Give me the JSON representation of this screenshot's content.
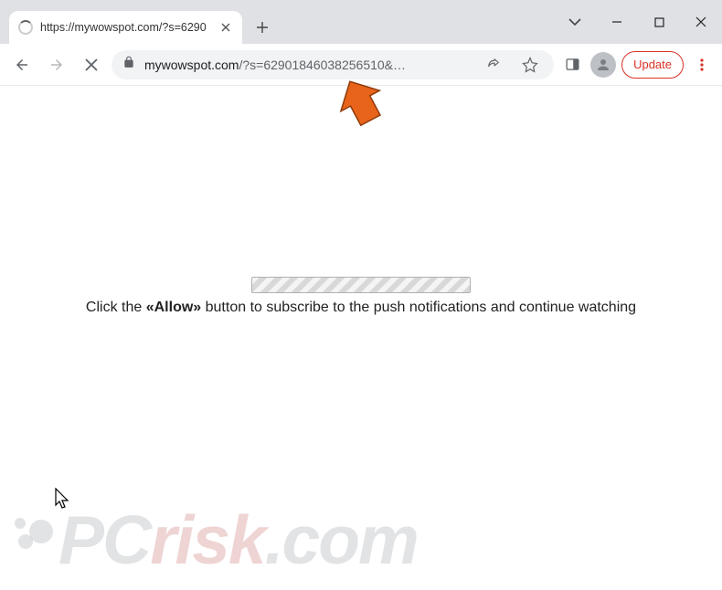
{
  "tab": {
    "title": "https://mywowspot.com/?s=6290"
  },
  "url": {
    "domain": "mywowspot.com",
    "path": "/?s=62901846038256510&…"
  },
  "toolbar": {
    "update_label": "Update"
  },
  "page": {
    "text_prefix": "Click the ",
    "text_allow": "«Allow»",
    "text_suffix": " button to subscribe to the push notifications and continue watching"
  },
  "watermark": {
    "pc": "PC",
    "risk": "risk",
    "tld": ".com"
  },
  "icons": {
    "back": "back-icon",
    "forward": "forward-icon",
    "stop": "stop-icon",
    "lock": "lock-icon",
    "share": "share-icon",
    "star": "star-icon",
    "panel": "side-panel-icon",
    "profile": "profile-icon",
    "menu": "menu-icon",
    "close_tab": "close-icon",
    "plus": "plus-icon",
    "chevron": "chevron-down-icon",
    "minimize": "minimize-icon",
    "maximize": "maximize-icon",
    "close_win": "close-icon"
  }
}
